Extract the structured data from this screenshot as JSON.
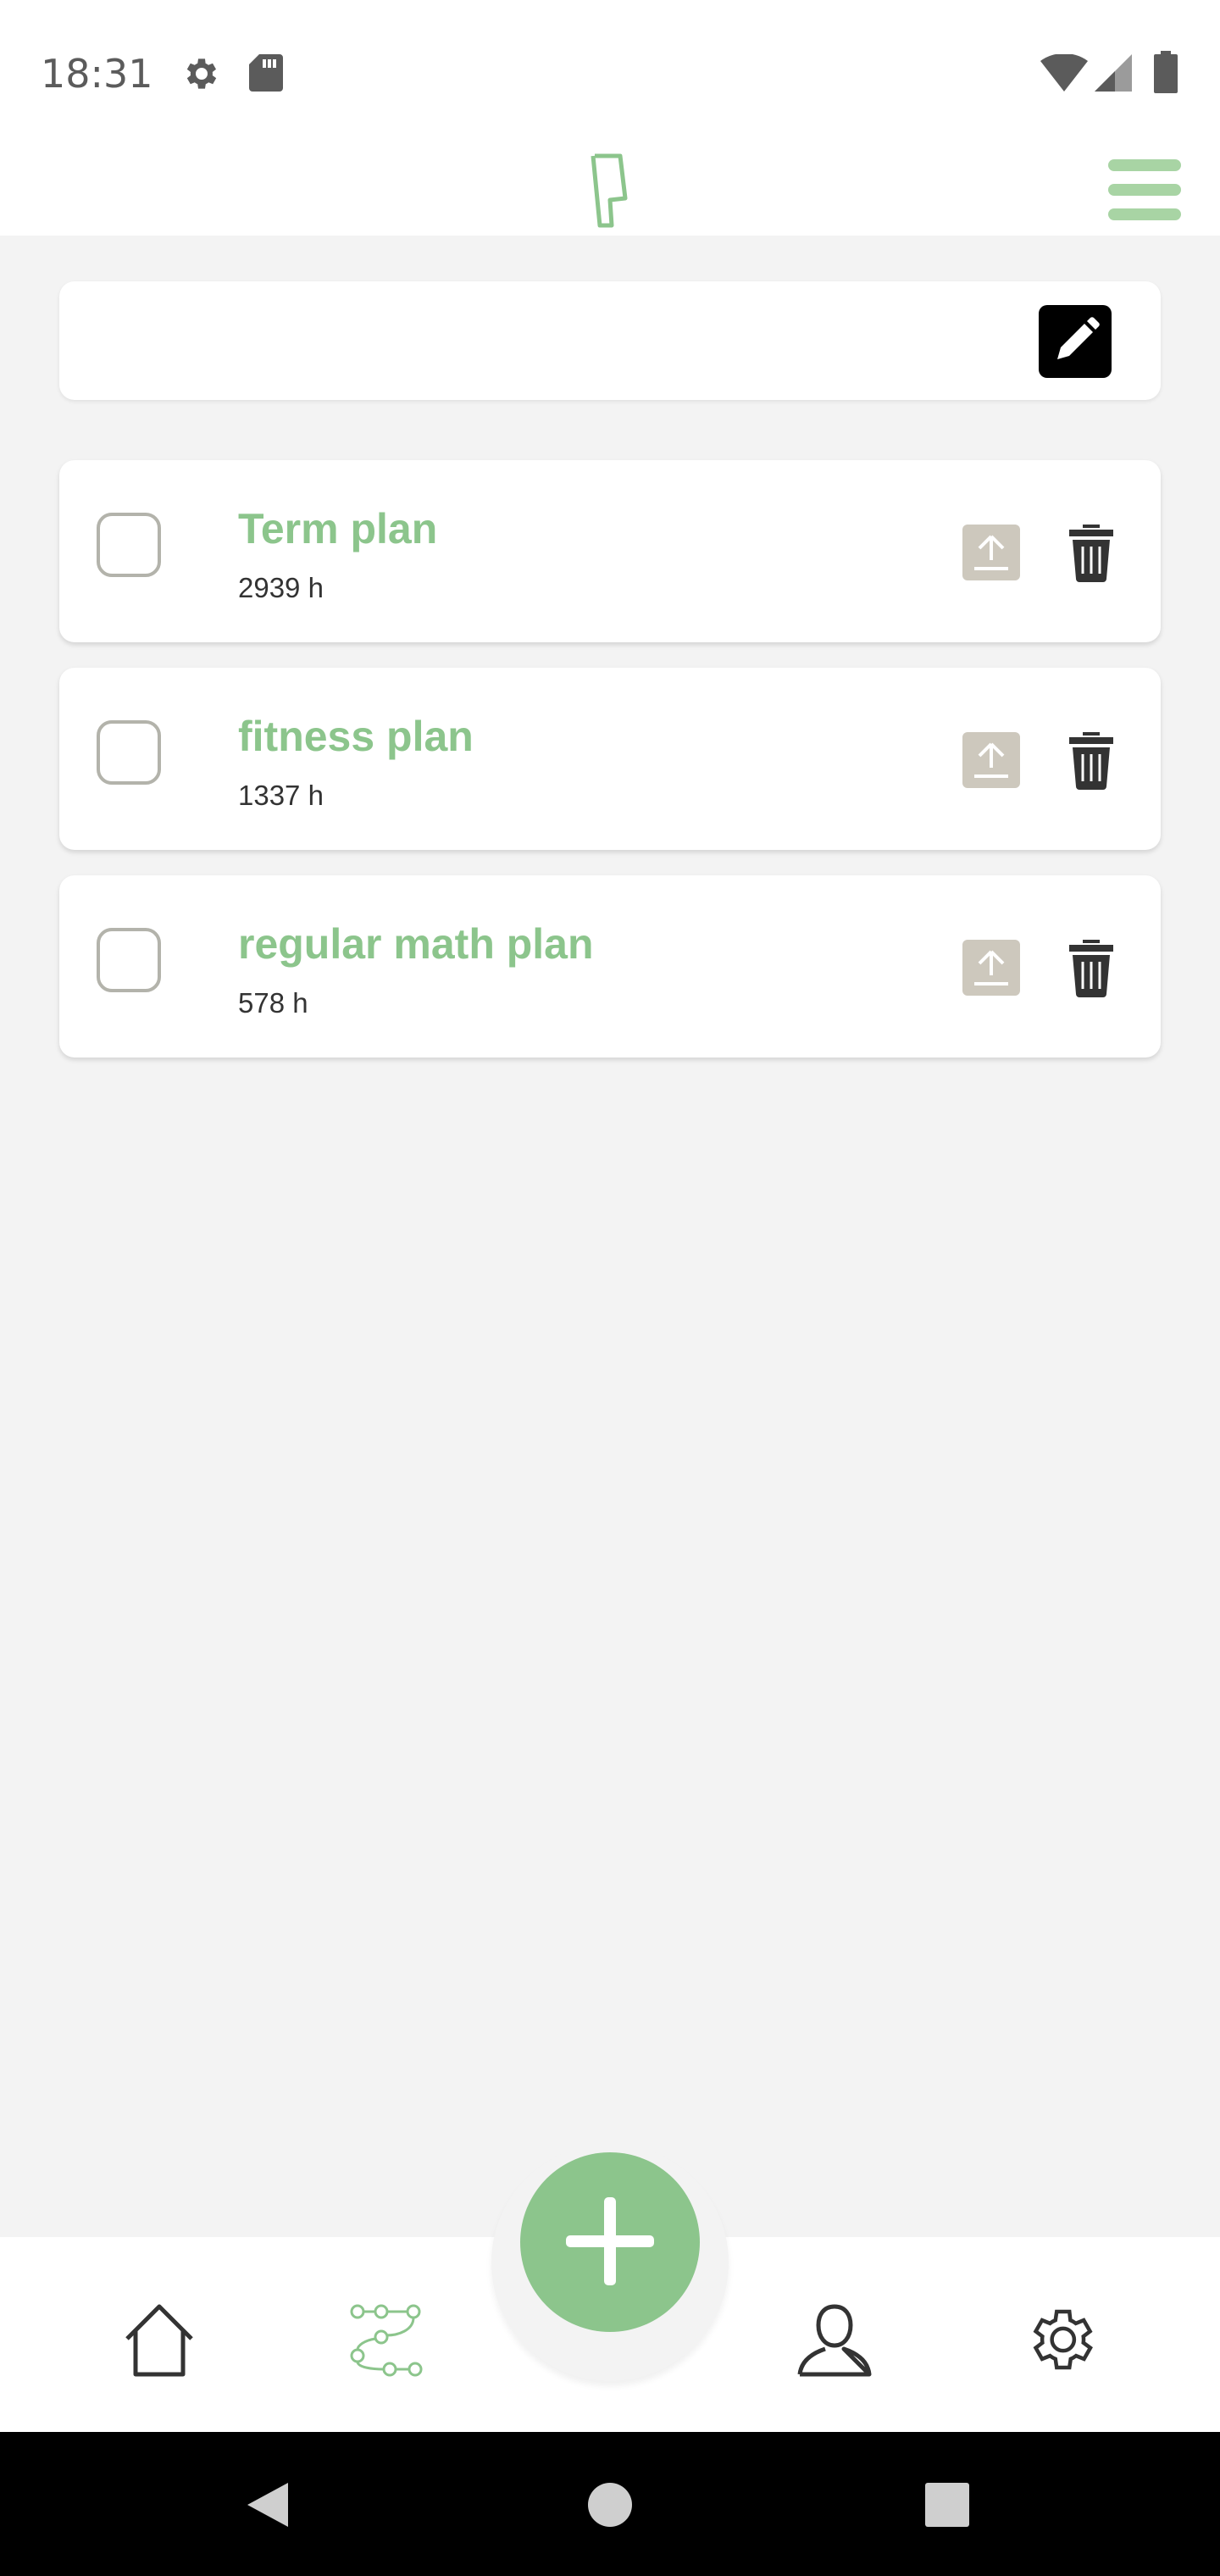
{
  "status_bar": {
    "time": "18:31",
    "icons": [
      "settings-icon",
      "sd-card-icon",
      "wifi-icon",
      "signal-icon",
      "battery-icon"
    ]
  },
  "header": {
    "logo": "app-logo",
    "menu_icon": "hamburger-menu-icon"
  },
  "search": {
    "value": "",
    "edit_icon": "pencil-icon"
  },
  "plans": [
    {
      "title": "Term plan",
      "hours": "2939 h",
      "checked": false
    },
    {
      "title": "fitness plan",
      "hours": "1337 h",
      "checked": false
    },
    {
      "title": "regular math plan",
      "hours": "578 h",
      "checked": false
    }
  ],
  "bottom_nav": {
    "items": [
      "home-icon",
      "plans-icon",
      "add-icon",
      "profile-icon",
      "settings-icon"
    ],
    "active": "plans-icon"
  },
  "colors": {
    "accent": "#8cc58c",
    "menu": "#a8d4a4",
    "upload_button": "#cdc8bd",
    "background": "#f3f3f3"
  }
}
